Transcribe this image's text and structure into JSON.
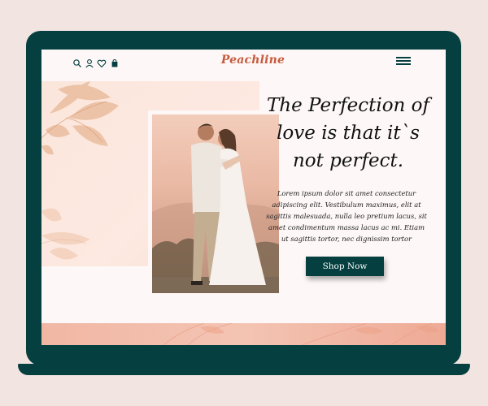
{
  "header": {
    "brand": "Peachline",
    "icons": [
      "search-icon",
      "user-icon",
      "heart-icon",
      "bag-icon"
    ],
    "menu_icon": "hamburger-menu-icon"
  },
  "hero": {
    "headline": "The Perfection of love is that it`s not perfect.",
    "body": "Lorem ipsum dolor sit amet consectetur adipiscing elit. Vestibulum maximus, elit at sagittis malesuada, nulla leo pretium lacus, sit amet condimentum massa lacus ac mi. Etiam ut sagittis tortor, nec dignissim tortor",
    "cta_label": "Shop Now"
  },
  "colors": {
    "background": "#f2e4e1",
    "laptop": "#053f3f",
    "accent_brand": "#c65a3c",
    "button": "#053f3f",
    "peach_band": "#f1b7a4"
  }
}
